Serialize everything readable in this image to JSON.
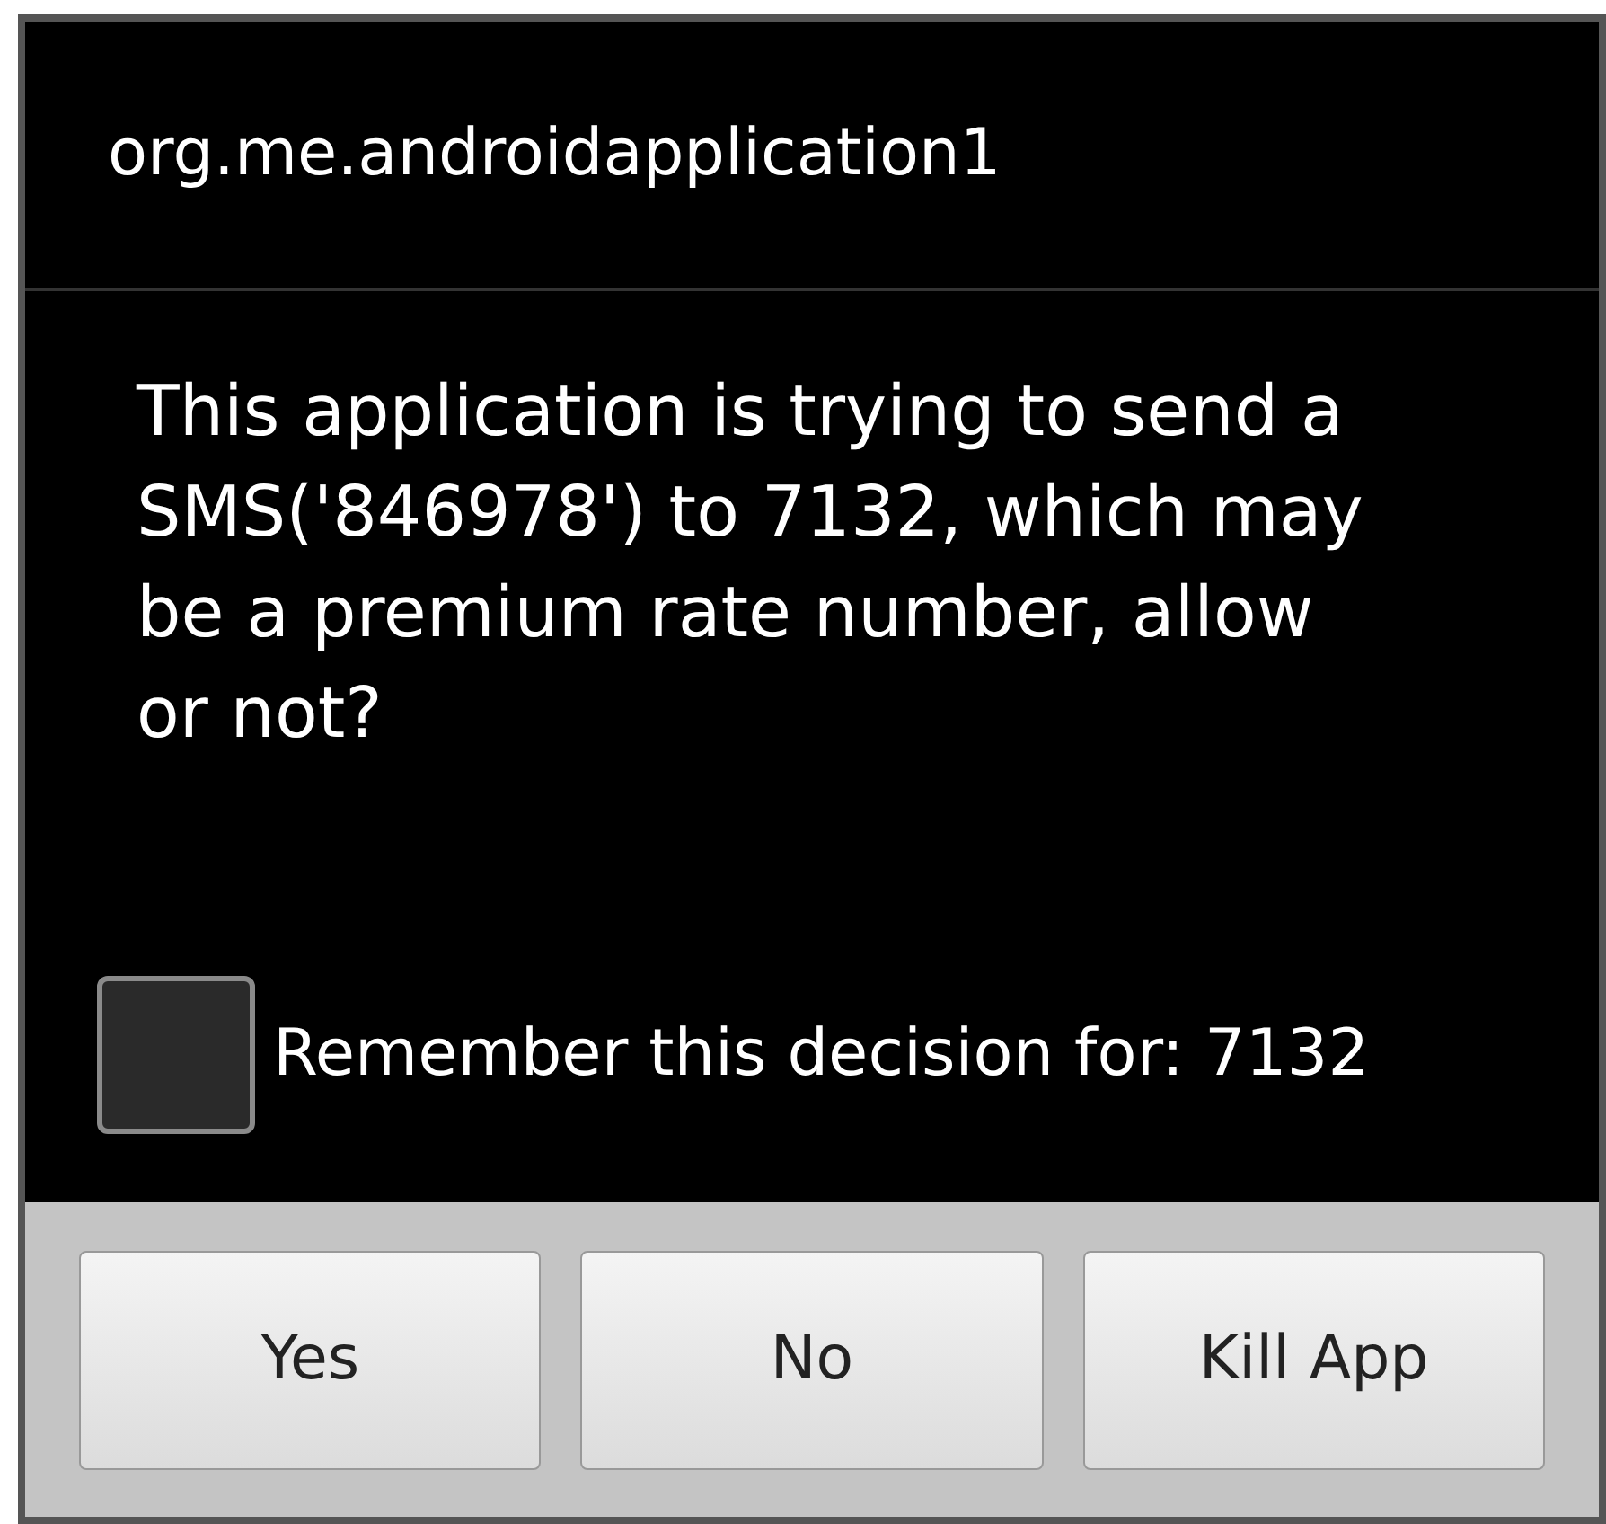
{
  "dialog": {
    "title": "org.me.androidapplication1",
    "message": "This application is trying to send a SMS('846978') to 7132, which may be a premium rate number, allow or not?",
    "remember": {
      "label": "Remember this decision for: 7132",
      "checked": false
    },
    "buttons": [
      "Yes",
      "No",
      "Kill App"
    ]
  }
}
